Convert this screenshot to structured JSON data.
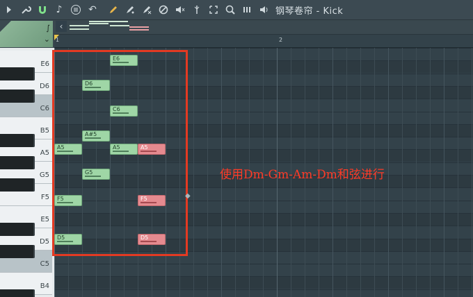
{
  "toolbar": {
    "title": "钢琴卷帘 - Kick",
    "icons": [
      "play-arrow-icon",
      "wrench-icon",
      "magnet-icon",
      "note-icon",
      "menu-icon",
      "undo-icon",
      "pencil-icon",
      "paint-icon",
      "delete-icon",
      "mute-icon",
      "slice-icon",
      "select-icon",
      "zoom-icon",
      "playback-icon",
      "speaker-icon"
    ]
  },
  "ruler": {
    "marks": [
      "1",
      "2"
    ]
  },
  "keyboard": {
    "labels": [
      "E6",
      "D6",
      "C6",
      "B5",
      "A5",
      "G5",
      "F5",
      "E5",
      "D5",
      "C5",
      "B4"
    ]
  },
  "notes": [
    {
      "label": "E6",
      "color": "green"
    },
    {
      "label": "D6",
      "color": "green"
    },
    {
      "label": "C6",
      "color": "green"
    },
    {
      "label": "A#5",
      "color": "green"
    },
    {
      "label": "A5",
      "color": "green"
    },
    {
      "label": "A5",
      "color": "green"
    },
    {
      "label": "A5",
      "color": "red"
    },
    {
      "label": "G5",
      "color": "green"
    },
    {
      "label": "F5",
      "color": "green"
    },
    {
      "label": "F5",
      "color": "red"
    },
    {
      "label": "D5",
      "color": "green"
    },
    {
      "label": "D5",
      "color": "red"
    }
  ],
  "annotation": "使用Dm-Gm-Am-Dm和弦进行",
  "colors": {
    "accent": "#7fe08a",
    "highlight": "#e33a22",
    "note_green": "#9fd6a6",
    "note_red": "#e58a8f"
  }
}
